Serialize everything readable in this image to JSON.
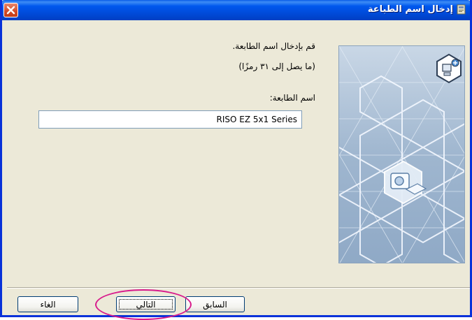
{
  "window": {
    "title": "إدخال اسم الطباعة"
  },
  "prompt": {
    "line1": "قم بإدخال اسم الطابعة.",
    "line2": "(ما يصل إلى ٣١ رمزًا)",
    "field_label": "اسم الطابعة:"
  },
  "printer_name": {
    "value": "RISO EZ 5x1 Series"
  },
  "buttons": {
    "back": "السابق",
    "next": "التالي",
    "cancel": "الغاء"
  },
  "colors": {
    "titlebar": "#0054e3",
    "highlight": "#d81b8c",
    "panel": "#aec3d8"
  },
  "icons": {
    "title": "installer-icon",
    "close": "close-icon",
    "panel_top": "computer-add-icon",
    "panel_center": "printer-icon"
  }
}
